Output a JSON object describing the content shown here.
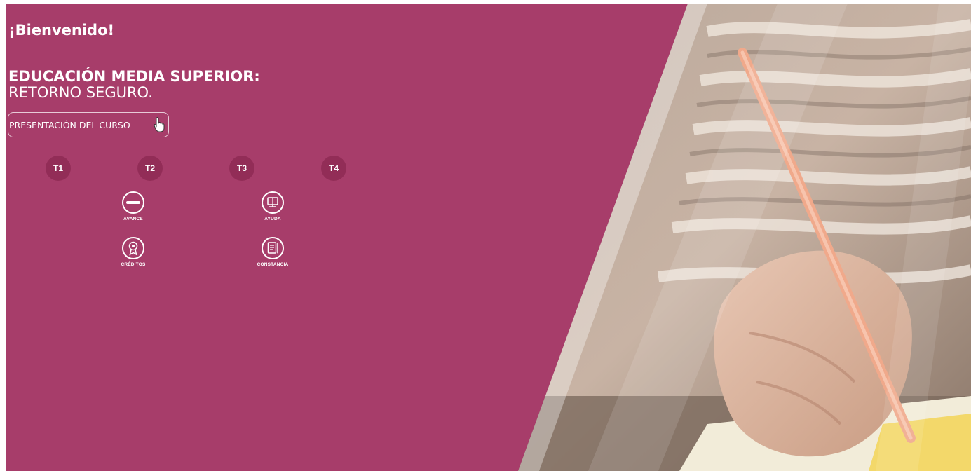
{
  "welcome": "¡Bienvenido!",
  "course": {
    "title_line1": "EDUCACIÓN MEDIA SUPERIOR:",
    "title_line2": "RETORNO SEGURO."
  },
  "presentation_button": {
    "label": "PRESENTACIÓN DEL CURSO"
  },
  "topics": [
    "T1",
    "T2",
    "T3",
    "T4"
  ],
  "tools": {
    "avance": "AVANCE",
    "ayuda": "AYUDA",
    "creditos": "CRÉDITOS",
    "constancia": "CONSTANCIA"
  },
  "icons": {
    "progress": "progress-icon",
    "help": "help-book-icon",
    "credits": "medal-icon",
    "certificate": "certificate-icon",
    "pointer": "hand-pointer-icon"
  },
  "colors": {
    "primary": "#a73d6a",
    "topic_circle": "#922d57",
    "text": "#ffffff"
  }
}
